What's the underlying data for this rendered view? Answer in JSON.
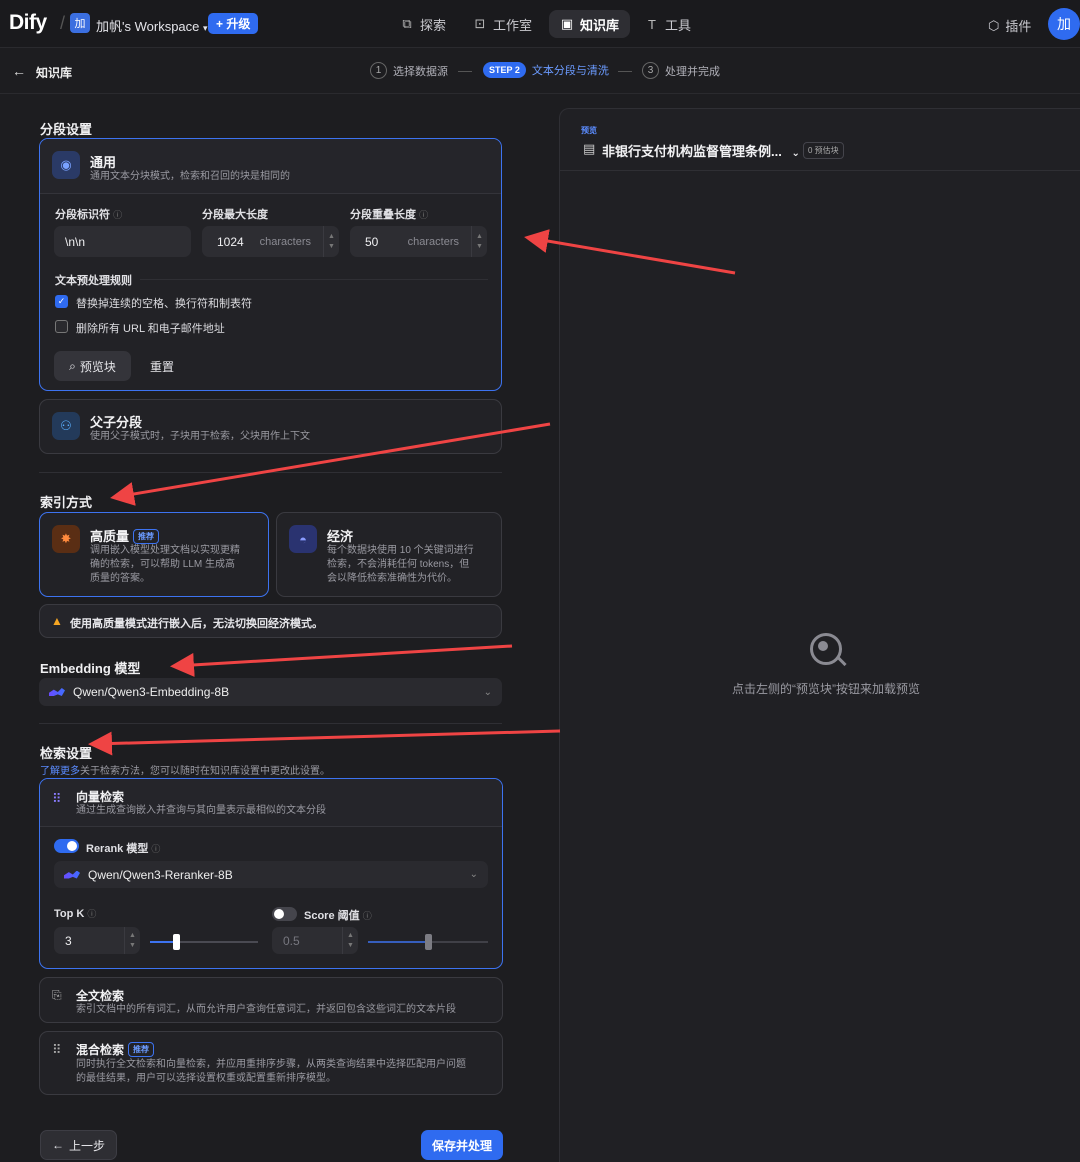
{
  "header": {
    "logo": "Dify",
    "workspace_badge": "加",
    "workspace_name": "加帆's Workspace",
    "upgrade_label": "升级",
    "nav": [
      {
        "label": "探索",
        "icon": "compass-icon"
      },
      {
        "label": "工作室",
        "icon": "robot-icon"
      },
      {
        "label": "知识库",
        "icon": "book-icon",
        "active": true
      },
      {
        "label": "工具",
        "icon": "hammer-icon"
      }
    ],
    "plugins_label": "插件",
    "avatar": "加"
  },
  "subheader": {
    "back_title": "知识库",
    "steps": [
      {
        "num": "1",
        "label": "选择数据源"
      },
      {
        "num": "STEP 2",
        "label": "文本分段与清洗",
        "active": true
      },
      {
        "num": "3",
        "label": "处理并完成"
      }
    ]
  },
  "segment": {
    "section_title": "分段设置",
    "general": {
      "title": "通用",
      "desc": "通用文本分块模式，检索和召回的块是相同的",
      "separator_label": "分段标识符",
      "separator_value": "\\n\\n",
      "max_len_label": "分段最大长度",
      "max_len_value": "1024",
      "max_len_unit": "characters",
      "overlap_label": "分段重叠长度",
      "overlap_value": "50",
      "overlap_unit": "characters",
      "rules_title": "文本预处理规则",
      "rule1": "替换掉连续的空格、换行符和制表符",
      "rule1_checked": true,
      "rule2": "删除所有 URL 和电子邮件地址",
      "rule2_checked": false,
      "preview_btn": "预览块",
      "reset_btn": "重置"
    },
    "parent_child": {
      "title": "父子分段",
      "desc": "使用父子模式时，子块用于检索，父块用作上下文"
    }
  },
  "index": {
    "section_title": "索引方式",
    "high": {
      "title": "高质量",
      "tag": "推荐",
      "desc": [
        "调用嵌入模型处理文档以实现更精",
        "确的检索，可以帮助 LLM 生成高",
        "质量的答案。"
      ]
    },
    "eco": {
      "title": "经济",
      "desc": [
        "每个数据块使用 10 个关键词进行",
        "检索，不会消耗任何 tokens，但",
        "会以降低检索准确性为代价。"
      ]
    },
    "warning": "使用高质量模式进行嵌入后，无法切换回经济模式。"
  },
  "embedding": {
    "section_title": "Embedding 模型",
    "model": "Qwen/Qwen3-Embedding-8B"
  },
  "retrieval": {
    "section_title": "检索设置",
    "learn_more": "了解更多",
    "hint": "关于检索方法，您可以随时在知识库设置中更改此设置。",
    "vector": {
      "title": "向量检索",
      "desc": "通过生成查询嵌入并查询与其向量表示最相似的文本分段",
      "rerank_label": "Rerank 模型",
      "rerank_on": true,
      "rerank_model": "Qwen/Qwen3-Reranker-8B",
      "topk_label": "Top K",
      "topk_value": "3",
      "topk_fraction": 0.24,
      "score_label": "Score 阈值",
      "score_on": false,
      "score_value": "0.5",
      "score_fraction": 0.5
    },
    "fulltext": {
      "title": "全文检索",
      "desc": "索引文档中的所有词汇，从而允许用户查询任意词汇，并返回包含这些词汇的文本片段"
    },
    "hybrid": {
      "title": "混合检索",
      "tag": "推荐",
      "desc": [
        "同时执行全文检索和向量检索，并应用重排序步骤，从两类查询结果中选择匹配用户问题",
        "的最佳结果，用户可以选择设置权重或配置重新排序模型。"
      ]
    }
  },
  "footer": {
    "prev": "上一步",
    "save": "保存并处理"
  },
  "preview": {
    "label": "预览",
    "doc_name": "非银行支付机构监督管理条例...",
    "estimate": "0 预估块",
    "empty_hint": "点击左侧的“预览块”按钮来加载预览"
  },
  "colors": {
    "accent": "#2f6bf0",
    "annotation_arrow": "#ef4444",
    "warning": "#f5a623"
  }
}
